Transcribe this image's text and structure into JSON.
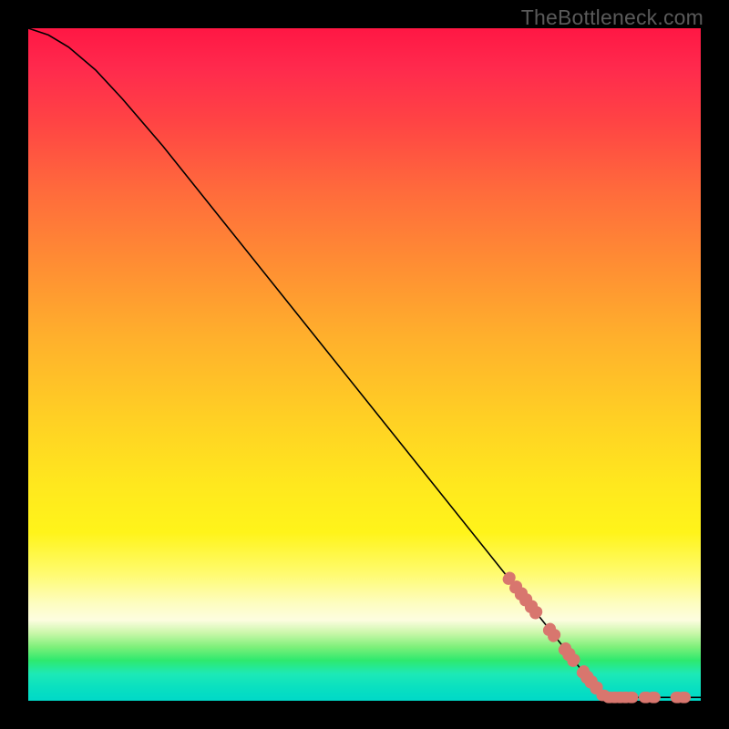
{
  "watermark": "TheBottleneck.com",
  "colors": {
    "marker": "#d8766e",
    "curve": "#000000"
  },
  "chart_data": {
    "type": "line",
    "title": "",
    "xlabel": "",
    "ylabel": "",
    "xlim": [
      0,
      100
    ],
    "ylim": [
      0,
      100
    ],
    "grid": false,
    "legend": false,
    "series": [
      {
        "name": "curve",
        "style": "line",
        "points": [
          {
            "x": 0.0,
            "y": 100.0
          },
          {
            "x": 3.0,
            "y": 99.0
          },
          {
            "x": 6.0,
            "y": 97.2
          },
          {
            "x": 10.0,
            "y": 93.8
          },
          {
            "x": 14.0,
            "y": 89.5
          },
          {
            "x": 20.0,
            "y": 82.5
          },
          {
            "x": 30.0,
            "y": 70.0
          },
          {
            "x": 40.0,
            "y": 57.5
          },
          {
            "x": 50.0,
            "y": 45.0
          },
          {
            "x": 60.0,
            "y": 32.5
          },
          {
            "x": 70.0,
            "y": 20.0
          },
          {
            "x": 78.0,
            "y": 10.0
          },
          {
            "x": 83.5,
            "y": 3.0
          },
          {
            "x": 85.5,
            "y": 0.8
          },
          {
            "x": 88.0,
            "y": 0.5
          },
          {
            "x": 92.0,
            "y": 0.5
          },
          {
            "x": 96.0,
            "y": 0.5
          },
          {
            "x": 100.0,
            "y": 0.5
          }
        ]
      },
      {
        "name": "markers",
        "style": "scatter",
        "points": [
          {
            "x": 71.5,
            "y": 18.2
          },
          {
            "x": 72.5,
            "y": 16.9
          },
          {
            "x": 73.3,
            "y": 15.9
          },
          {
            "x": 74.0,
            "y": 15.0
          },
          {
            "x": 74.8,
            "y": 14.0
          },
          {
            "x": 75.5,
            "y": 13.1
          },
          {
            "x": 77.5,
            "y": 10.6
          },
          {
            "x": 78.2,
            "y": 9.7
          },
          {
            "x": 79.8,
            "y": 7.7
          },
          {
            "x": 80.4,
            "y": 6.9
          },
          {
            "x": 81.1,
            "y": 6.0
          },
          {
            "x": 82.5,
            "y": 4.3
          },
          {
            "x": 83.1,
            "y": 3.5
          },
          {
            "x": 83.7,
            "y": 2.8
          },
          {
            "x": 84.5,
            "y": 1.9
          },
          {
            "x": 85.5,
            "y": 0.8
          },
          {
            "x": 86.4,
            "y": 0.5
          },
          {
            "x": 87.2,
            "y": 0.5
          },
          {
            "x": 88.0,
            "y": 0.5
          },
          {
            "x": 88.8,
            "y": 0.5
          },
          {
            "x": 89.7,
            "y": 0.5
          },
          {
            "x": 91.8,
            "y": 0.5
          },
          {
            "x": 93.0,
            "y": 0.5
          },
          {
            "x": 96.5,
            "y": 0.5
          },
          {
            "x": 97.5,
            "y": 0.5
          }
        ]
      }
    ]
  }
}
